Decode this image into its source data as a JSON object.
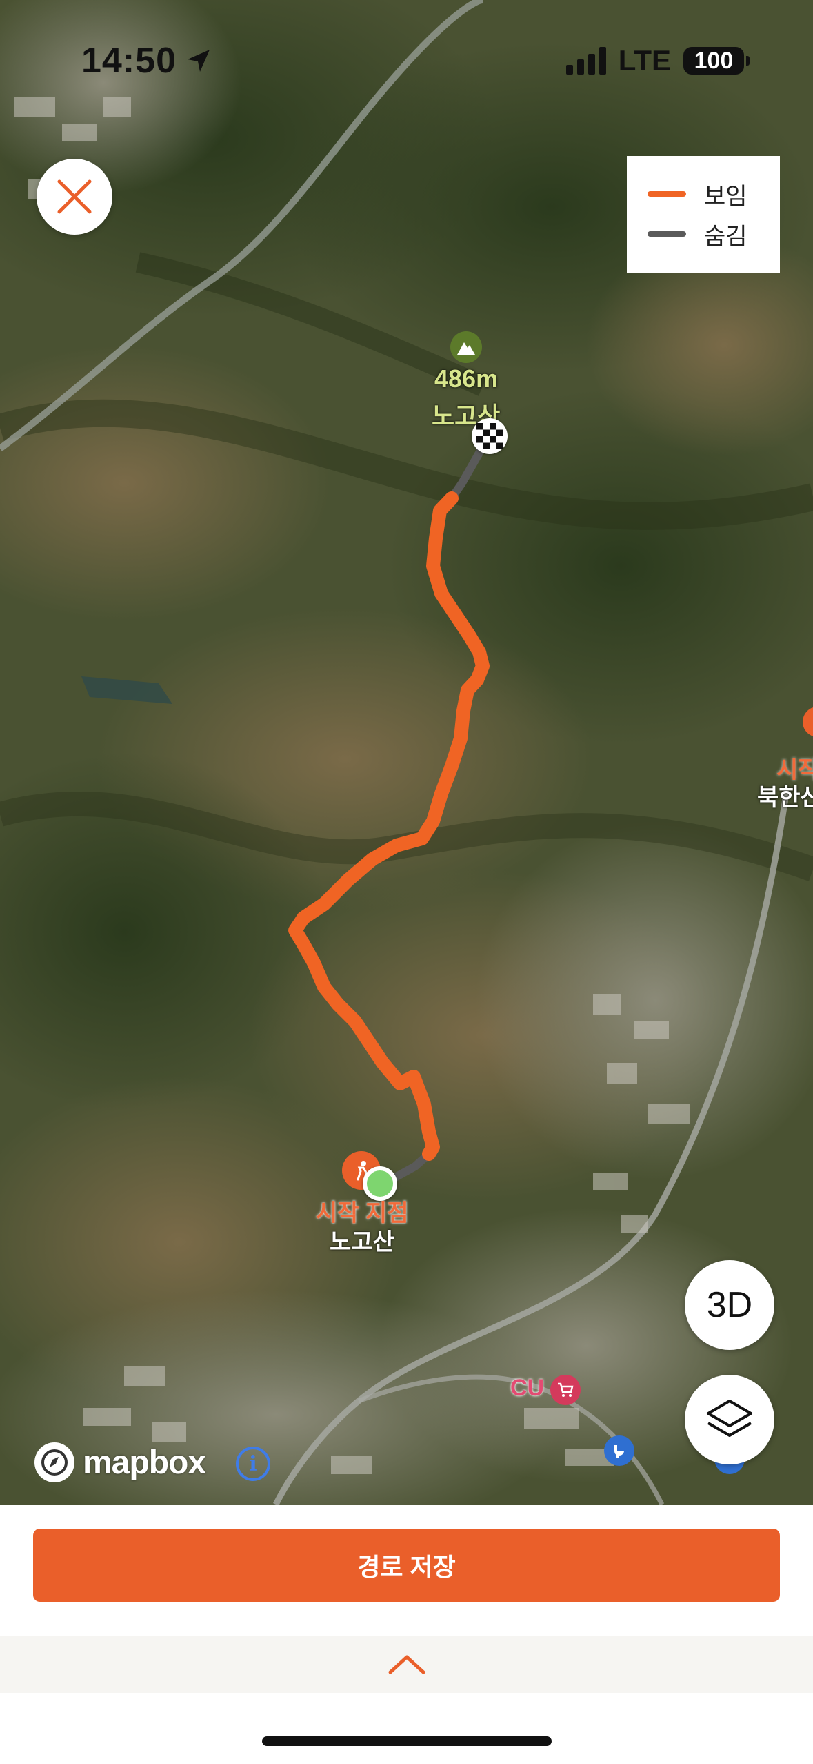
{
  "status_bar": {
    "time": "14:50",
    "network": "LTE",
    "battery": "100"
  },
  "legend": {
    "items": [
      {
        "label": "보임",
        "color": "#f06424"
      },
      {
        "label": "숨김",
        "color": "#5a5a5a"
      }
    ]
  },
  "map": {
    "peak": {
      "elevation": "486m",
      "name": "노고산",
      "icon": "mountain-icon"
    },
    "start": {
      "label": "시작 지점",
      "name": "노고산",
      "icon": "hiker-icon"
    },
    "right_poi": {
      "label": "시작",
      "name": "북한산"
    },
    "store": {
      "label": "CU",
      "icon": "cart-icon"
    },
    "attribution": {
      "logo_text": "mapbox",
      "info": "i"
    },
    "route_colors": {
      "visible": "#f06424",
      "hidden": "#5a5a5a"
    }
  },
  "buttons": {
    "three_d": "3D",
    "layers_icon": "layers-icon",
    "close_icon": "close-icon"
  },
  "bottom": {
    "save_label": "경로 저장",
    "expand_icon": "chevron-up-icon"
  },
  "colors": {
    "accent": "#ea5f2a"
  }
}
